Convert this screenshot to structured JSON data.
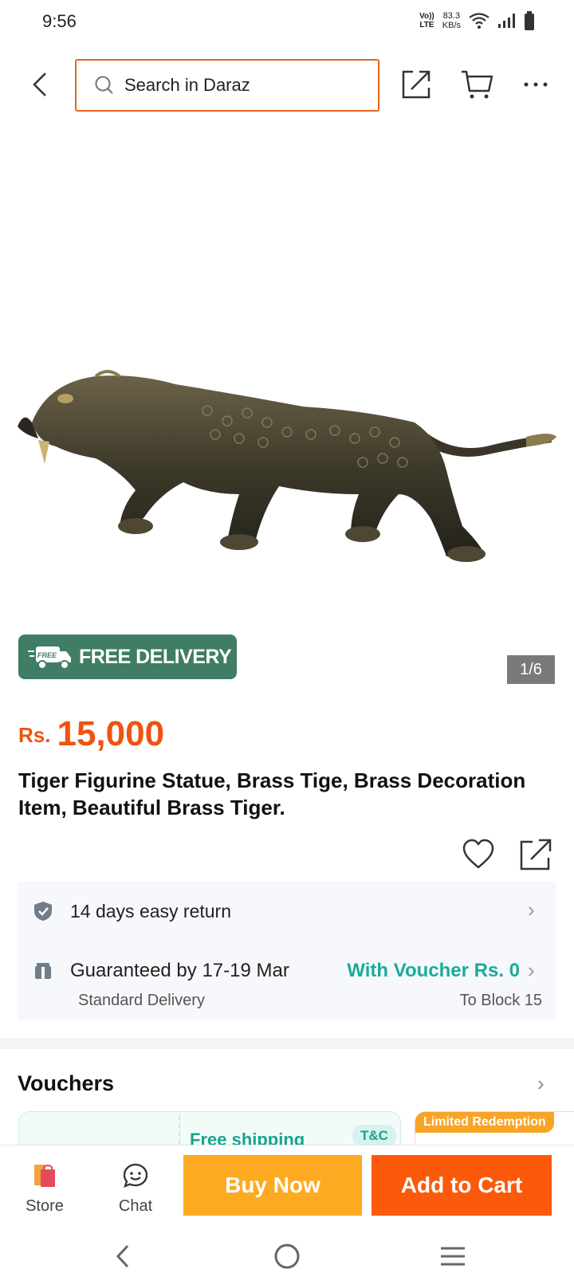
{
  "status_bar": {
    "time": "9:56",
    "volte_top": "Vo))",
    "volte_bottom": "LTE",
    "speed_value": "83.3",
    "speed_unit": "KB/s"
  },
  "header": {
    "search_placeholder": "Search in Daraz",
    "icons": [
      "back-arrow-icon",
      "search-icon",
      "share-icon",
      "cart-icon",
      "more-icon"
    ]
  },
  "product": {
    "image_alt": "Brass tiger figurine",
    "free_delivery_badge": "FREE",
    "free_delivery_label": "FREE DELIVERY",
    "image_counter": "1/6",
    "currency": "Rs.",
    "price": "15,000",
    "title": "Tiger Figurine Statue, Brass Tige, Brass Decoration Item, Beautiful Brass Tiger."
  },
  "info": {
    "return_text": "14 days easy return",
    "delivery_main": "Guaranteed by 17-19 Mar",
    "delivery_sub": "Standard Delivery",
    "voucher_text": "With Voucher Rs. 0",
    "location": "To Block 15"
  },
  "vouchers": {
    "title": "Vouchers",
    "card1_label": "Free shipping",
    "card1_tag": "T&C",
    "card2_tag": "Limited Redemption"
  },
  "action_bar": {
    "store_label": "Store",
    "chat_label": "Chat",
    "buy_now_label": "Buy Now",
    "add_to_cart_label": "Add to Cart"
  },
  "colors": {
    "brand_orange": "#f0530f",
    "buy_now": "#fdaa22",
    "add_to_cart": "#fb5a0a",
    "free_delivery_green": "#3f7d65",
    "voucher_teal": "#1bab9a"
  }
}
